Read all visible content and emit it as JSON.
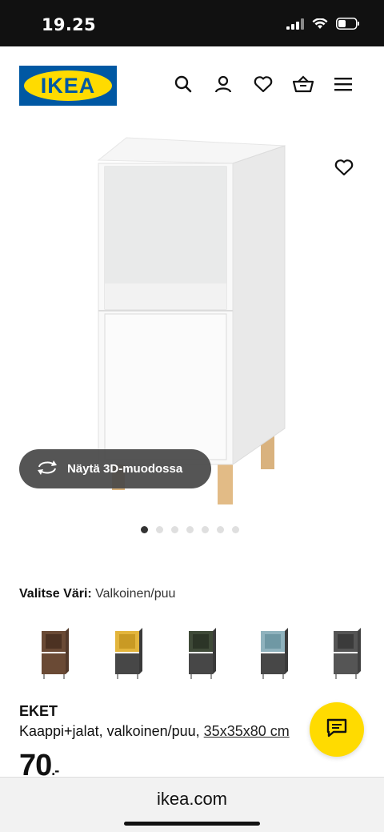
{
  "status": {
    "time": "19.25"
  },
  "header": {
    "logo_text": "IKEA"
  },
  "hero": {
    "view_3d_label": "Näytä 3D-muodossa",
    "image_count": 7,
    "active_image": 1
  },
  "color": {
    "label": "Valitse Väri:",
    "value": "Valkoinen/puu"
  },
  "swatches": [
    {
      "name": "brown",
      "top": "#6a4a35",
      "bottom": "#6a4a35"
    },
    {
      "name": "yellow",
      "top": "#e3b53c",
      "bottom": "#4a4a4a"
    },
    {
      "name": "green",
      "top": "#3f4a38",
      "bottom": "#4a4a4a"
    },
    {
      "name": "blue",
      "top": "#8fb2bd",
      "bottom": "#4a4a4a"
    },
    {
      "name": "dark-grey",
      "top": "#555555",
      "bottom": "#555555"
    }
  ],
  "product": {
    "name": "EKET",
    "desc_text": "Kaappi+jalat, valkoinen/puu, ",
    "desc_dims": "35x35x80 cm",
    "price_main": "70",
    "price_suffix": ".-"
  },
  "browser": {
    "url": "ikea.com"
  },
  "colors": {
    "brand_blue": "#0058a3",
    "brand_yellow": "#ffdb00"
  }
}
